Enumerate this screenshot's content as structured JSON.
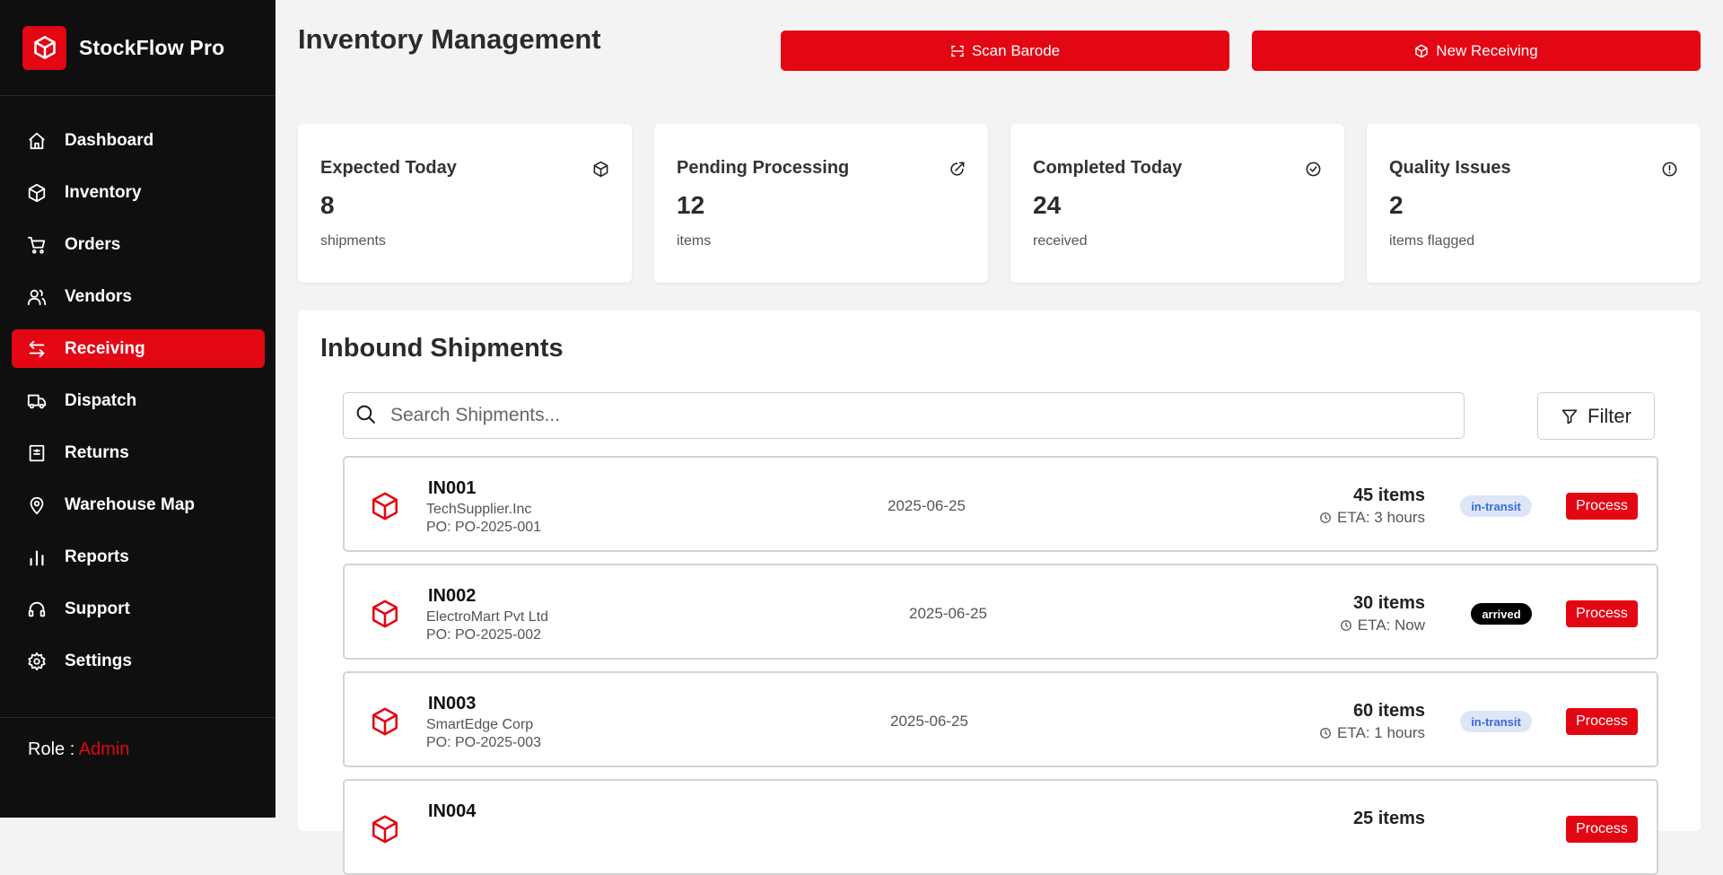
{
  "app": {
    "name": "StockFlow Pro",
    "brand_color": "#e30613",
    "logo_icon": "cube-icon"
  },
  "sidebar": {
    "items": [
      {
        "label": "Dashboard",
        "icon": "home-icon",
        "active": false
      },
      {
        "label": "Inventory",
        "icon": "box-icon",
        "active": false
      },
      {
        "label": "Orders",
        "icon": "cart-icon",
        "active": false
      },
      {
        "label": "Vendors",
        "icon": "users-icon",
        "active": false
      },
      {
        "label": "Receiving",
        "icon": "arrows-swap-icon",
        "active": true
      },
      {
        "label": "Dispatch",
        "icon": "truck-icon",
        "active": false
      },
      {
        "label": "Returns",
        "icon": "receipt-icon",
        "active": false
      },
      {
        "label": "Warehouse Map",
        "icon": "map-pin-icon",
        "active": false
      },
      {
        "label": "Reports",
        "icon": "bar-chart-icon",
        "active": false
      },
      {
        "label": "Support",
        "icon": "headset-icon",
        "active": false
      },
      {
        "label": "Settings",
        "icon": "gear-icon",
        "active": false
      }
    ],
    "role_label": "Role :",
    "role_value": "Admin"
  },
  "header": {
    "title": "Inventory Management",
    "scan_label": "Scan Barode",
    "new_receiving_label": "New Receiving"
  },
  "stats": [
    {
      "title": "Expected Today",
      "value": "8",
      "sub": "shipments",
      "icon": "box-icon"
    },
    {
      "title": "Pending Processing",
      "value": "12",
      "sub": "items",
      "icon": "edit-circle-icon"
    },
    {
      "title": "Completed Today",
      "value": "24",
      "sub": "received",
      "icon": "check-circle-icon"
    },
    {
      "title": "Quality Issues",
      "value": "2",
      "sub": "items flagged",
      "icon": "alert-circle-icon"
    }
  ],
  "shipments": {
    "title": "Inbound Shipments",
    "search_placeholder": "Search Shipments...",
    "filter_label": "Filter",
    "process_label": "Process",
    "rows": [
      {
        "id": "IN001",
        "vendor": "TechSupplier.Inc",
        "po": "PO: PO-2025-001",
        "date": "2025-06-25",
        "items": "45 items",
        "eta": "ETA: 3 hours",
        "status": "in-transit"
      },
      {
        "id": "IN002",
        "vendor": "ElectroMart Pvt Ltd",
        "po": "PO: PO-2025-002",
        "date": "2025-06-25",
        "items": "30 items",
        "eta": "ETA: Now",
        "status": "arrived"
      },
      {
        "id": "IN003",
        "vendor": "SmartEdge Corp",
        "po": "PO: PO-2025-003",
        "date": "2025-06-25",
        "items": "60 items",
        "eta": "ETA: 1 hours",
        "status": "in-transit"
      },
      {
        "id": "IN004",
        "vendor": "",
        "po": "",
        "date": "",
        "items": "25 items",
        "eta": "",
        "status": ""
      }
    ]
  }
}
